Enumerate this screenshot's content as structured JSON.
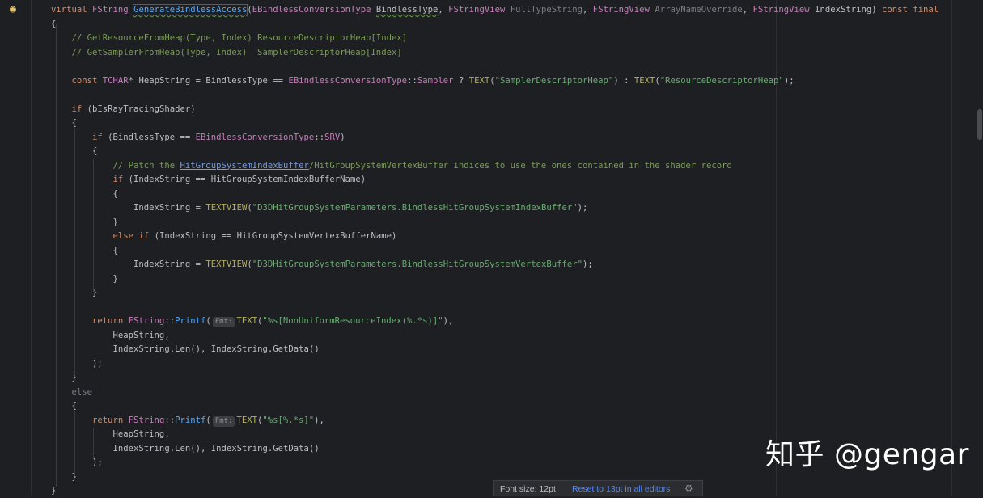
{
  "editor": {
    "lines": [
      [
        {
          "t": "virtual ",
          "c": "kw"
        },
        {
          "t": "FString ",
          "c": "type"
        },
        {
          "t": "GenerateBindlessAccess",
          "c": "fn",
          "x": "squiggle caret-box"
        },
        {
          "t": "(",
          "c": "punct"
        },
        {
          "t": "EBindlessConversionType ",
          "c": "type"
        },
        {
          "t": "BindlessType",
          "c": "punct",
          "x": "squiggle"
        },
        {
          "t": ", ",
          "c": "punct"
        },
        {
          "t": "FStringView ",
          "c": "type"
        },
        {
          "t": "FullTypeString",
          "c": "gray"
        },
        {
          "t": ", ",
          "c": "punct"
        },
        {
          "t": "FStringView ",
          "c": "type"
        },
        {
          "t": "ArrayNameOverride",
          "c": "gray"
        },
        {
          "t": ", ",
          "c": "punct"
        },
        {
          "t": "FStringView ",
          "c": "type"
        },
        {
          "t": "IndexString",
          "c": "punct"
        },
        {
          "t": ") ",
          "c": "punct"
        },
        {
          "t": "const final",
          "c": "kw"
        }
      ],
      [
        {
          "t": "{",
          "c": "punct"
        }
      ],
      [
        {
          "t": "    // GetResourceFromHeap(Type, Index) ResourceDescriptorHeap[Index]",
          "c": "com"
        }
      ],
      [
        {
          "t": "    // GetSamplerFromHeap(Type, Index)  SamplerDescriptorHeap[Index]",
          "c": "com"
        }
      ],
      [],
      [
        {
          "t": "    const ",
          "c": "kw"
        },
        {
          "t": "TCHAR",
          "c": "type"
        },
        {
          "t": "* ",
          "c": "punct"
        },
        {
          "t": "HeapString ",
          "c": "punct"
        },
        {
          "t": "= ",
          "c": "punct"
        },
        {
          "t": "BindlessType ",
          "c": "punct"
        },
        {
          "t": "== ",
          "c": "punct"
        },
        {
          "t": "EBindlessConversionType",
          "c": "type"
        },
        {
          "t": "::",
          "c": "punct"
        },
        {
          "t": "Sampler ",
          "c": "type"
        },
        {
          "t": "? ",
          "c": "punct"
        },
        {
          "t": "TEXT",
          "c": "mac"
        },
        {
          "t": "(",
          "c": "punct"
        },
        {
          "t": "\"SamplerDescriptorHeap\"",
          "c": "str"
        },
        {
          "t": ") : ",
          "c": "punct"
        },
        {
          "t": "TEXT",
          "c": "mac"
        },
        {
          "t": "(",
          "c": "punct"
        },
        {
          "t": "\"ResourceDescriptorHeap\"",
          "c": "str"
        },
        {
          "t": ");",
          "c": "punct"
        }
      ],
      [],
      [
        {
          "t": "    if ",
          "c": "kw"
        },
        {
          "t": "(bIsRayTracingShader)",
          "c": "punct"
        }
      ],
      [
        {
          "t": "    {",
          "c": "punct"
        }
      ],
      [
        {
          "t": "        if ",
          "c": "kw"
        },
        {
          "t": "(BindlessType ",
          "c": "punct"
        },
        {
          "t": "== ",
          "c": "punct"
        },
        {
          "t": "EBindlessConversionType",
          "c": "type"
        },
        {
          "t": "::",
          "c": "punct"
        },
        {
          "t": "SRV",
          "c": "type"
        },
        {
          "t": ")",
          "c": "punct"
        }
      ],
      [
        {
          "t": "        {",
          "c": "punct"
        }
      ],
      [
        {
          "t": "            // Patch the ",
          "c": "com"
        },
        {
          "t": "HitGroupSystemIndexBuffer",
          "c": "link"
        },
        {
          "t": "/HitGroupSystemVertexBuffer indices to use the ones contained in the shader record",
          "c": "com"
        }
      ],
      [
        {
          "t": "            if ",
          "c": "kw"
        },
        {
          "t": "(IndexString ",
          "c": "punct"
        },
        {
          "t": "== ",
          "c": "punct"
        },
        {
          "t": "HitGroupSystemIndexBufferName)",
          "c": "punct"
        }
      ],
      [
        {
          "t": "            {",
          "c": "punct"
        }
      ],
      [
        {
          "t": "                IndexString ",
          "c": "punct"
        },
        {
          "t": "= ",
          "c": "punct"
        },
        {
          "t": "TEXTVIEW",
          "c": "mac"
        },
        {
          "t": "(",
          "c": "punct"
        },
        {
          "t": "\"D3DHitGroupSystemParameters.BindlessHitGroupSystemIndexBuffer\"",
          "c": "str"
        },
        {
          "t": ");",
          "c": "punct"
        }
      ],
      [
        {
          "t": "            }",
          "c": "punct"
        }
      ],
      [
        {
          "t": "            else if ",
          "c": "kw"
        },
        {
          "t": "(IndexString ",
          "c": "punct"
        },
        {
          "t": "== ",
          "c": "punct"
        },
        {
          "t": "HitGroupSystemVertexBufferName)",
          "c": "punct"
        }
      ],
      [
        {
          "t": "            {",
          "c": "punct"
        }
      ],
      [
        {
          "t": "                IndexString ",
          "c": "punct"
        },
        {
          "t": "= ",
          "c": "punct"
        },
        {
          "t": "TEXTVIEW",
          "c": "mac"
        },
        {
          "t": "(",
          "c": "punct"
        },
        {
          "t": "\"D3DHitGroupSystemParameters.BindlessHitGroupSystemVertexBuffer\"",
          "c": "str"
        },
        {
          "t": ");",
          "c": "punct"
        }
      ],
      [
        {
          "t": "            }",
          "c": "punct"
        }
      ],
      [
        {
          "t": "        }",
          "c": "punct"
        }
      ],
      [],
      [
        {
          "t": "        return ",
          "c": "kw"
        },
        {
          "t": "FString",
          "c": "type"
        },
        {
          "t": "::",
          "c": "punct"
        },
        {
          "t": "Printf",
          "c": "fn"
        },
        {
          "t": "(",
          "c": "punct"
        },
        {
          "t": "Fmt:",
          "c": "hint"
        },
        {
          "t": "TEXT",
          "c": "mac"
        },
        {
          "t": "(",
          "c": "punct"
        },
        {
          "t": "\"%s[NonUniformResourceIndex(%.*s)]\"",
          "c": "str"
        },
        {
          "t": "),",
          "c": "punct"
        }
      ],
      [
        {
          "t": "            HeapString,",
          "c": "punct"
        }
      ],
      [
        {
          "t": "            IndexString.",
          "c": "punct"
        },
        {
          "t": "Len",
          "c": "punct"
        },
        {
          "t": "(), IndexString.",
          "c": "punct"
        },
        {
          "t": "GetData",
          "c": "punct"
        },
        {
          "t": "()",
          "c": "punct"
        }
      ],
      [
        {
          "t": "        );",
          "c": "punct"
        }
      ],
      [
        {
          "t": "    }",
          "c": "punct"
        }
      ],
      [
        {
          "t": "    else",
          "c": "gray"
        }
      ],
      [
        {
          "t": "    {",
          "c": "punct"
        }
      ],
      [
        {
          "t": "        return ",
          "c": "kw"
        },
        {
          "t": "FString",
          "c": "type"
        },
        {
          "t": "::",
          "c": "punct"
        },
        {
          "t": "Printf",
          "c": "fn"
        },
        {
          "t": "(",
          "c": "punct"
        },
        {
          "t": "Fmt:",
          "c": "hint"
        },
        {
          "t": "TEXT",
          "c": "mac"
        },
        {
          "t": "(",
          "c": "punct"
        },
        {
          "t": "\"%s[%.*s]\"",
          "c": "str"
        },
        {
          "t": "),",
          "c": "punct"
        }
      ],
      [
        {
          "t": "            HeapString,",
          "c": "punct"
        }
      ],
      [
        {
          "t": "            IndexString.",
          "c": "punct"
        },
        {
          "t": "Len",
          "c": "punct"
        },
        {
          "t": "(), IndexString.",
          "c": "punct"
        },
        {
          "t": "GetData",
          "c": "punct"
        },
        {
          "t": "()",
          "c": "punct"
        }
      ],
      [
        {
          "t": "        );",
          "c": "punct"
        }
      ],
      [
        {
          "t": "    }",
          "c": "punct"
        }
      ],
      [
        {
          "t": "}",
          "c": "punct"
        }
      ]
    ]
  },
  "popup": {
    "font_label": "Font size: 12pt",
    "reset_link": "Reset to 13pt in all editors"
  },
  "watermark": {
    "text": "知乎 @gengar"
  },
  "icons": {
    "gutter": "lightbulb-icon",
    "popup": "settings-icon"
  }
}
